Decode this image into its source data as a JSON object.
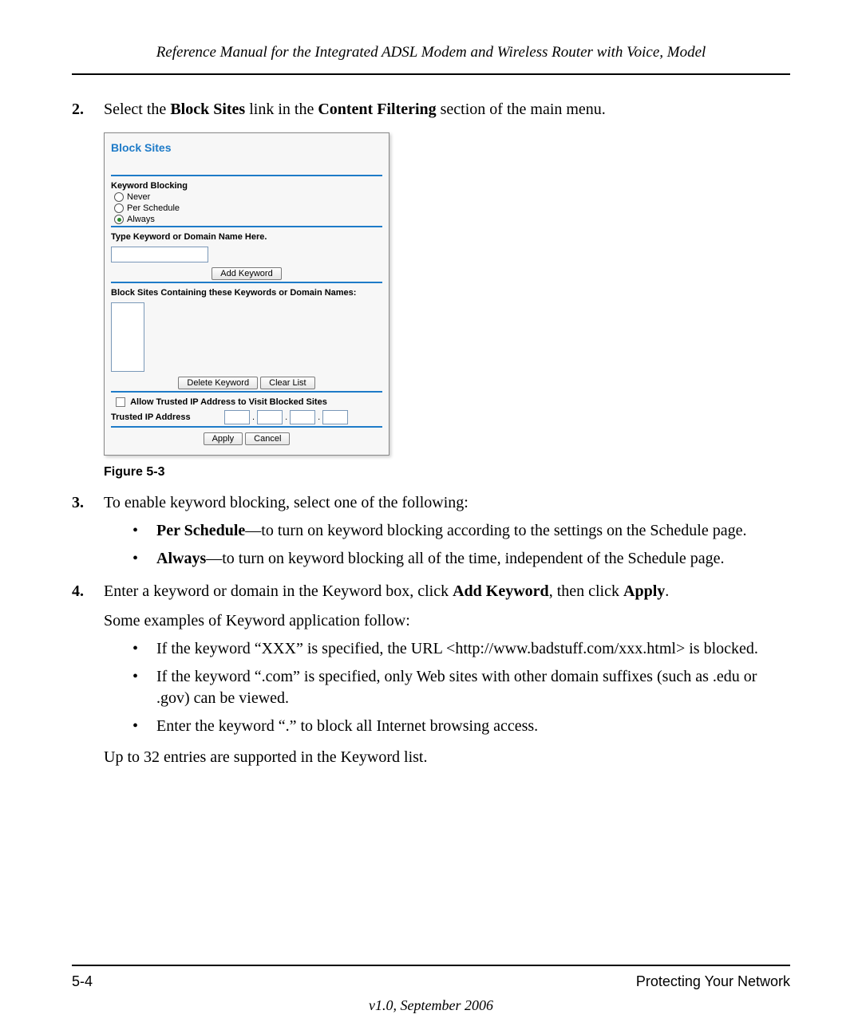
{
  "header": {
    "running": "Reference Manual for the Integrated ADSL Modem and Wireless Router with Voice, Model"
  },
  "steps": {
    "s2": {
      "num": "2.",
      "pre": "Select the ",
      "b1": "Block Sites",
      "mid": " link in the ",
      "b2": "Content Filtering",
      "post": " section of the main menu."
    },
    "s3": {
      "num": "3.",
      "text": "To enable keyword blocking, select one of the following:",
      "bul1_b": "Per Schedule",
      "bul1_t": "—to turn on keyword blocking according to the settings on the Schedule page.",
      "bul2_b": "Always",
      "bul2_t": "—to turn on keyword blocking all of the time, independent of the Schedule page."
    },
    "s4": {
      "num": "4.",
      "pre": "Enter a keyword or domain in the Keyword box, click ",
      "b1": "Add Keyword",
      "mid": ", then click ",
      "b2": "Apply",
      "post": ".",
      "after1": "Some examples of Keyword application follow:",
      "bul1": "If the keyword “XXX” is specified, the URL <http://www.badstuff.com/xxx.html> is blocked.",
      "bul2": "If the keyword “.com” is specified, only Web sites with other domain suffixes (such as .edu or .gov) can be viewed.",
      "bul3": "Enter the keyword “.” to block all Internet browsing access.",
      "after2": "Up to 32 entries are supported in the Keyword list."
    }
  },
  "panel": {
    "title": "Block Sites",
    "kb_label": "Keyword Blocking",
    "opt_never": "Never",
    "opt_sched": "Per Schedule",
    "opt_always": "Always",
    "type_label": "Type Keyword or Domain Name Here.",
    "add_btn": "Add Keyword",
    "block_label": "Block Sites Containing these Keywords or Domain Names:",
    "del_btn": "Delete Keyword",
    "clear_btn": "Clear List",
    "allow_label": "Allow Trusted IP Address to Visit Blocked Sites",
    "trusted_label": "Trusted IP Address",
    "apply_btn": "Apply",
    "cancel_btn": "Cancel"
  },
  "figure": {
    "label": "Figure 5-3"
  },
  "footer": {
    "pagenum": "5-4",
    "section": "Protecting Your Network",
    "version": "v1.0, September 2006"
  }
}
